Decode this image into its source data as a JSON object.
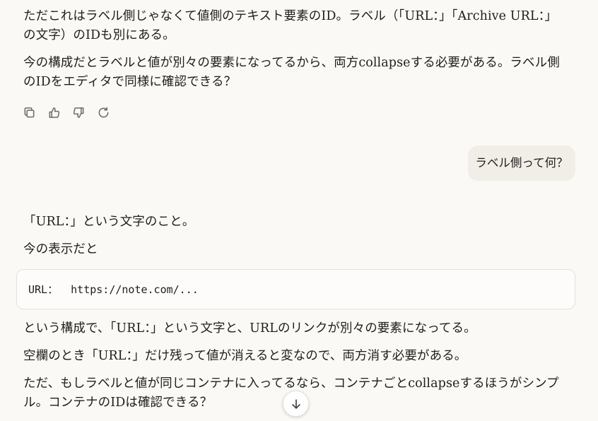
{
  "assistant_message_1": {
    "para_1": "ただこれはラベル側じゃなくて値側のテキスト要素のID。ラベル（「URL：」「Archive URL：」の文字）のIDも別にある。",
    "para_2": "今の構成だとラベルと値が別々の要素になってるから、両方collapseする必要がある。ラベル側のIDをエディタで同様に確認できる？"
  },
  "message_actions": [
    {
      "name": "copy-icon"
    },
    {
      "name": "thumbs-up-icon"
    },
    {
      "name": "thumbs-down-icon"
    },
    {
      "name": "retry-icon"
    }
  ],
  "user_message": {
    "text": "ラベル側って何？"
  },
  "assistant_message_2": {
    "para_1": "「URL：」という文字のこと。",
    "para_2": "今の表示だと",
    "code": "URL：  https://note.com/...",
    "para_3": "という構成で、「URL：」という文字と、URLのリンクが別々の要素になってる。",
    "para_4": "空欄のとき「URL：」だけ残って値が消えると変なので、両方消す必要がある。",
    "para_5": "ただ、もしラベルと値が同じコンテナに入ってるなら、コンテナごとcollapseするほうがシンプル。コンテナのIDは確認できる？"
  },
  "scroll_button": {
    "icon": "arrow-down-icon"
  }
}
